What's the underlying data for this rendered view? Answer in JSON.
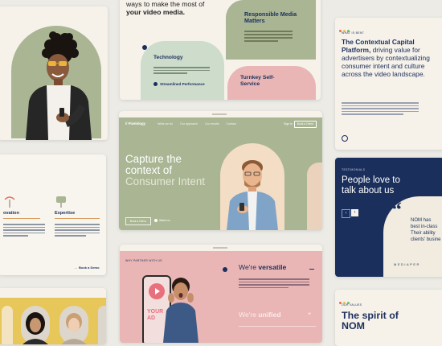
{
  "colors": {
    "sage": "#a9b593",
    "sage_dark": "#8e9c75",
    "pink": "#e9b6b5",
    "navy": "#1b2f5c",
    "cream": "#f6f2ea",
    "yellow": "#e7c65a",
    "mint": "#cddccb"
  },
  "intro": {
    "line": "ways to make the most of",
    "line2": "your video media."
  },
  "responsible": {
    "title_line1": "Responsible Media",
    "title_line2": "Matters"
  },
  "technology": {
    "title": "Technology",
    "item": "Streamlined Performance"
  },
  "turnkey": {
    "title_line1": "Turnkey Self-",
    "title_line2": "Service"
  },
  "contextual": {
    "eyebrow": "WHAT IS BENT",
    "title": "The Contextual Capital Platform,",
    "body": "driving value for advertisers by contextualizing consumer intent and culture across the video landscape."
  },
  "hero": {
    "logo": "// Pixelology",
    "nav": [
      "What we do",
      "Our approach",
      "Our results",
      "Contact"
    ],
    "signin": "Sign in",
    "cta": "Book a Demo",
    "headline_line1": "Capture the",
    "headline_line2": "context of",
    "headline_line3": "Consumer Intent",
    "button_demo": "Book a Demo",
    "button_learn": "Watch us"
  },
  "innovation": {
    "col1_title": "ovation",
    "col2_title": "Expertise",
    "link": "Book a Demo"
  },
  "testimonials": {
    "eyebrow": "TESTIMONIALS",
    "title_line1": "People love to",
    "title_line2": "talk about us",
    "quote_mark": "“",
    "quote_line1": "NOM has",
    "quote_line2": "best in-class",
    "quote_line3": "Their ability",
    "quote_line4": "clients' busine",
    "signature": "MEDIAPER"
  },
  "partner": {
    "eyebrow": "WHY PARTNER WITH US",
    "bubble": "YOUR AD",
    "row1_prefix": "We're ",
    "row1_em": "versatile",
    "row2_prefix": "We're ",
    "row2_em": "unified"
  },
  "spirit": {
    "eyebrow": "OUR VALUES",
    "title_line1": "The spirit of",
    "title_line2": "NOM"
  }
}
